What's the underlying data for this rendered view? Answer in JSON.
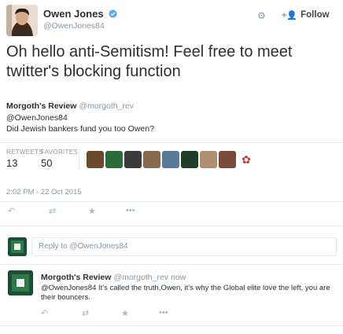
{
  "header": {
    "author_name": "Owen Jones",
    "author_handle": "@OwenJones84",
    "follow_label": "Follow"
  },
  "tweet": {
    "text": "Oh hello anti-Semitism! Feel free to meet twitter's blocking function"
  },
  "quoted": {
    "name": "Morgoth's Review",
    "handle": "@morgoth_rev",
    "line1": "@OwenJones84",
    "line2": "Did Jewish bankers fund you too Owen?"
  },
  "stats": {
    "retweets_label": "RETWEETS",
    "retweets_value": "13",
    "favorites_label": "FAVORITES",
    "favorites_value": "50"
  },
  "timestamp": "2:02 PM - 22 Oct 2015",
  "reply_box": {
    "placeholder": "Reply to @OwenJones84"
  },
  "reply": {
    "name": "Morgoth's Review",
    "handle": "@morgoth_rev",
    "time": "now",
    "text": "@OwenJones84 It's called the truth,Owen, it's why the Global elite love the left, you are their bouncers."
  },
  "colors": {
    "text": "#292f33",
    "muted": "#8899a6",
    "verified": "#55acee",
    "divider": "#e6ecf0"
  },
  "icons": [
    "verified-icon",
    "gear-icon",
    "follow-person-icon",
    "reply-icon",
    "retweet-icon",
    "favorite-icon",
    "more-icon"
  ]
}
